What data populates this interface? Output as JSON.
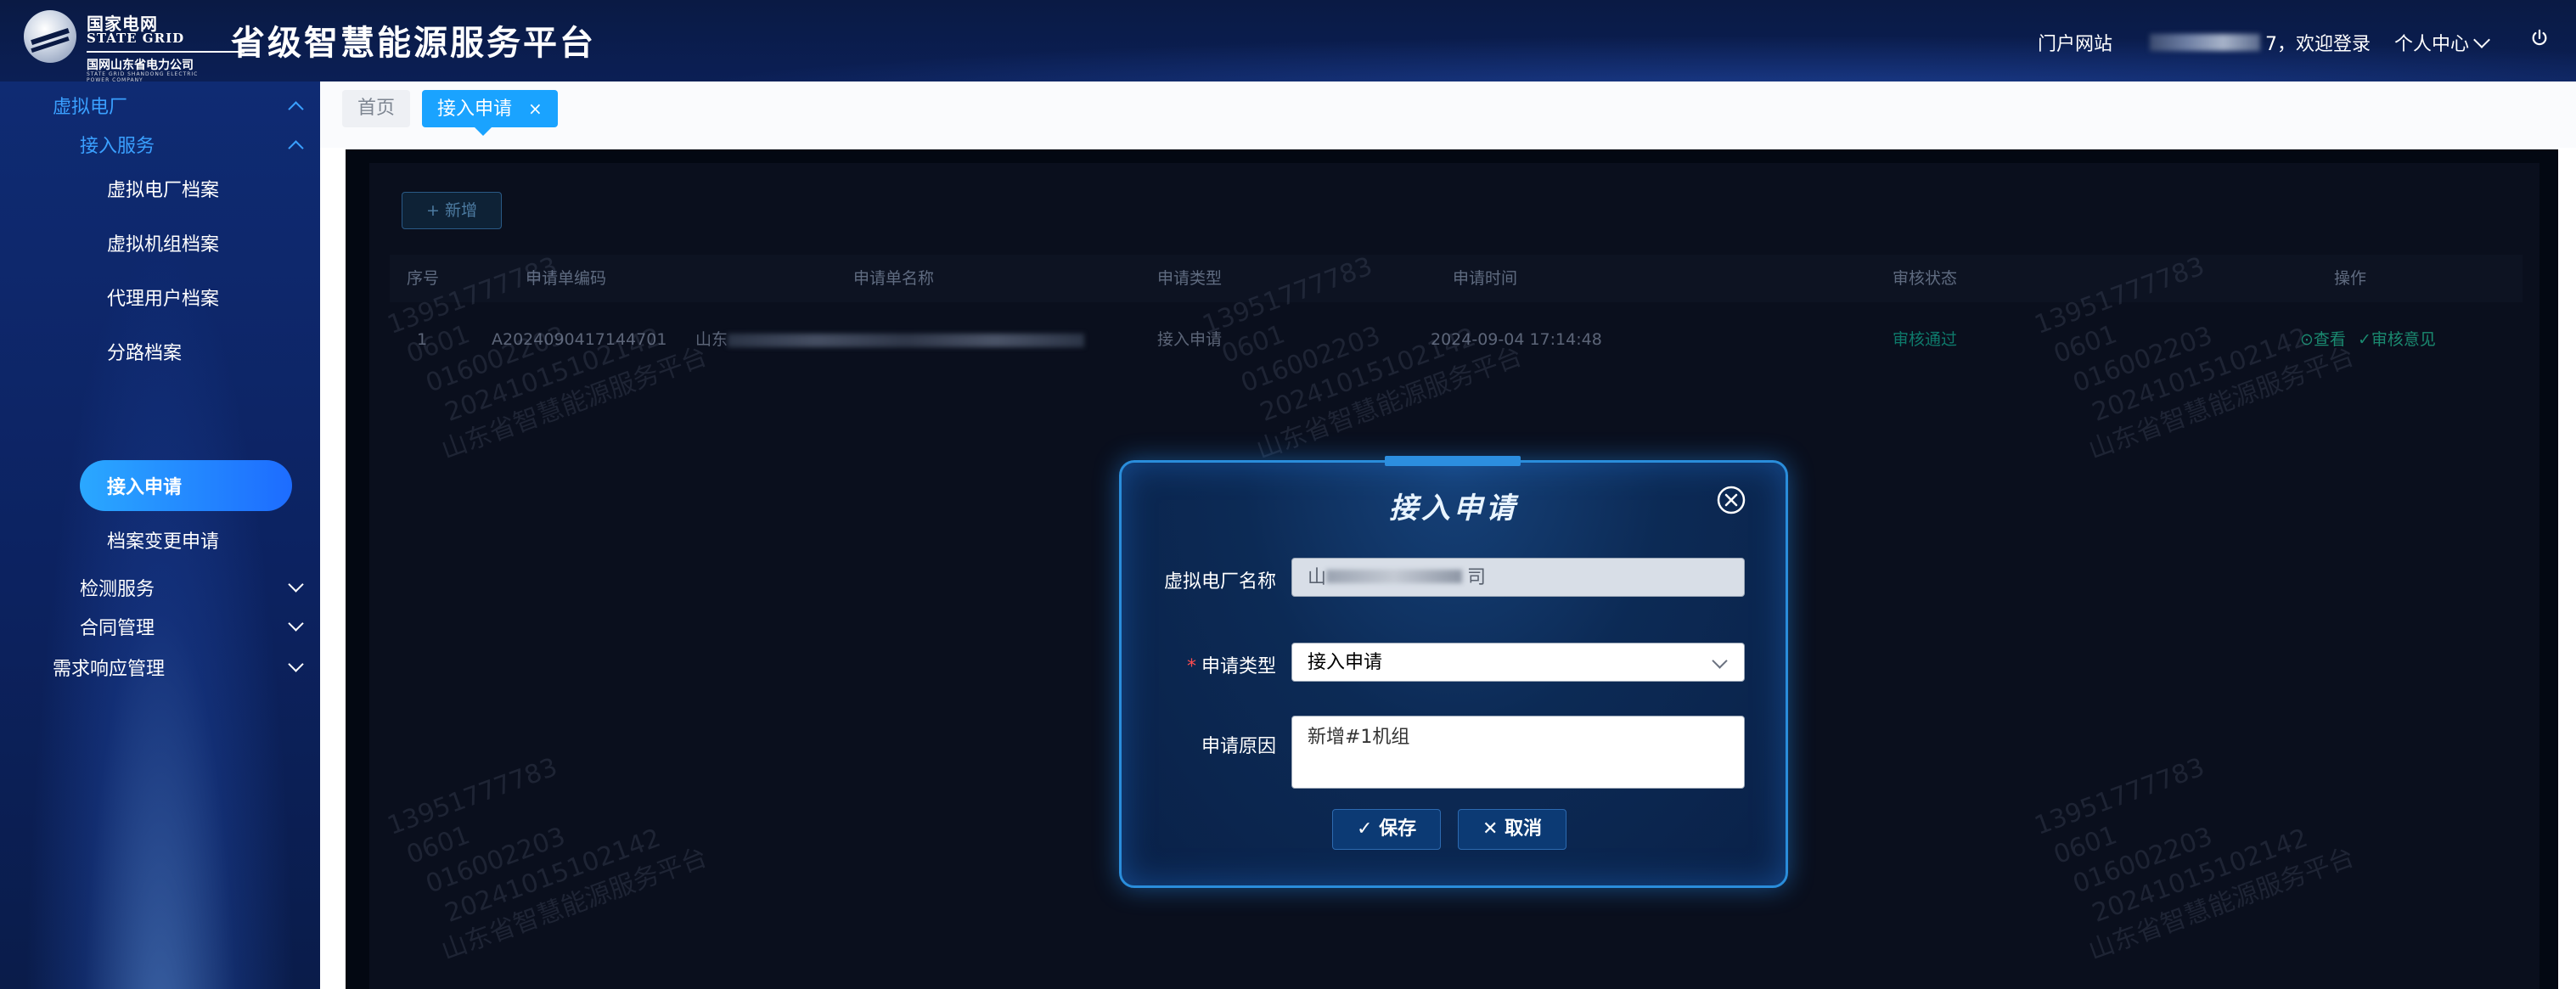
{
  "header": {
    "logo_cn": "国家电网",
    "logo_en": "STATE GRID",
    "logo_sub": "国网山东省电力公司",
    "logo_sub_en": "STATE GRID SHANDONG ELECTRIC POWER COMPANY",
    "app_title": "省级智慧能源服务平台",
    "portal_link": "门户网站",
    "user_suffix": "7，欢迎登录",
    "user_center": "个人中心"
  },
  "sidebar": {
    "group_vpp": "虚拟电厂",
    "sub_access": "接入服务",
    "items": [
      "虚拟电厂档案",
      "虚拟机组档案",
      "代理用户档案",
      "分路档案",
      "接入申请",
      "档案变更申请"
    ],
    "active_index": 4,
    "sub_detect": "检测服务",
    "sub_contract": "合同管理",
    "group_demand": "需求响应管理"
  },
  "tabs": {
    "home": "首页",
    "active": "接入申请",
    "close": "×"
  },
  "toolbar": {
    "add_label": "新增",
    "add_icon": "+"
  },
  "table": {
    "headers": [
      "序号",
      "申请单编码",
      "申请单名称",
      "申请类型",
      "申请时间",
      "审核状态",
      "操作"
    ],
    "rows": [
      {
        "index": "1",
        "code": "A2024090417144701",
        "name_prefix": "山东",
        "name_suffix": "",
        "type": "接入申请",
        "time": "2024-09-04 17:14:48",
        "status": "审核通过",
        "action_view": "查看",
        "action_opinion": "审核意见"
      }
    ]
  },
  "watermark": {
    "lines": [
      "13951777783",
      "0601",
      "016002203",
      "20241015102142",
      "山东省智慧能源服务平台"
    ]
  },
  "modal": {
    "title": "接入申请",
    "fields": {
      "vpp_name_label": "虚拟电厂名称",
      "vpp_name_value_prefix": "山",
      "vpp_name_value_suffix": "司",
      "type_label": "申请类型",
      "type_value": "接入申请",
      "reason_label": "申请原因",
      "reason_value": "新增#1机组"
    },
    "save_label": "保存",
    "cancel_label": "取消"
  },
  "colors": {
    "header_bg": "#0a1a44",
    "sidebar_bg": "#0f2b73",
    "active_pill": "#1aa3ff",
    "tab_active": "#1aa3ff",
    "status_ok": "#0e7a6b",
    "modal_border": "#2a8ddb"
  }
}
